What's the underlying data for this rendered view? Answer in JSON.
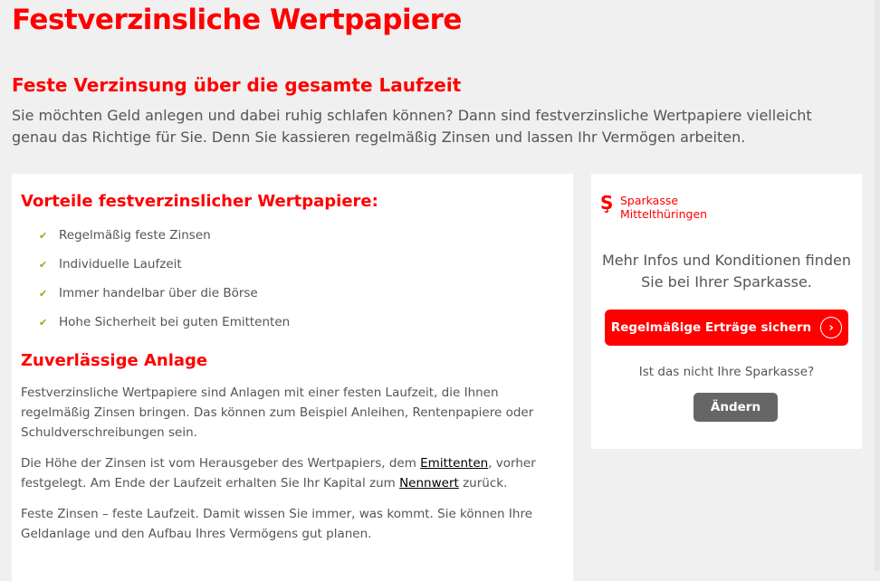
{
  "page": {
    "title": "Festverzinsliche Wertpapiere",
    "subtitle": "Feste Verzinsung über die gesamte Laufzeit",
    "intro": "Sie möchten Geld anlegen und dabei ruhig schlafen können? Dann sind festverzinsliche Wertpapiere vielleicht genau das Richtige für Sie. Denn Sie kassieren regelmäßig Zinsen und lassen Ihr Vermögen arbeiten."
  },
  "main": {
    "advantages_heading": "Vorteile festverzinslicher Wertpapiere:",
    "advantages": [
      "Regelmäßig feste Zinsen",
      "Individuelle Laufzeit",
      "Immer handelbar über die Börse",
      "Hohe Sicherheit bei guten Emittenten"
    ],
    "check_icon": "check-icon",
    "check_color": "#7ab51d",
    "reliable_heading": "Zuverlässige Anlage",
    "p1": "Festverzinsliche Wertpapiere sind Anlagen mit einer festen Laufzeit, die Ihnen regelmäßig Zinsen bringen. Das können zum Beispiel Anleihen, Rentenpapiere oder Schuldverschreibungen sein.",
    "p2_a": "Die Höhe der Zinsen ist vom Herausgeber des Wertpapiers, dem ",
    "p2_link1": "Emittenten",
    "p2_b": ", vorher festgelegt. Am Ende der Laufzeit erhalten Sie Ihr Kapital zum ",
    "p2_link2": "Nennwert",
    "p2_c": " zurück.",
    "p3": "Feste Zinsen – feste Laufzeit. Damit wissen Sie immer, was kommt. Sie können Ihre Geldanlage und den Aufbau Ihres Vermögens gut planen."
  },
  "sidebar": {
    "logo_line1": "Sparkasse",
    "logo_line2": "Mittelthüringen",
    "info": "Mehr Infos und Konditionen finden Sie bei Ihrer Sparkasse.",
    "cta_label": "Regelmäßige Erträge sichern",
    "question": "Ist das nicht Ihre Sparkasse?",
    "change_label": "Ändern"
  },
  "colors": {
    "brand": "#ff0000",
    "text": "#555555",
    "background": "#f0f0f0"
  }
}
